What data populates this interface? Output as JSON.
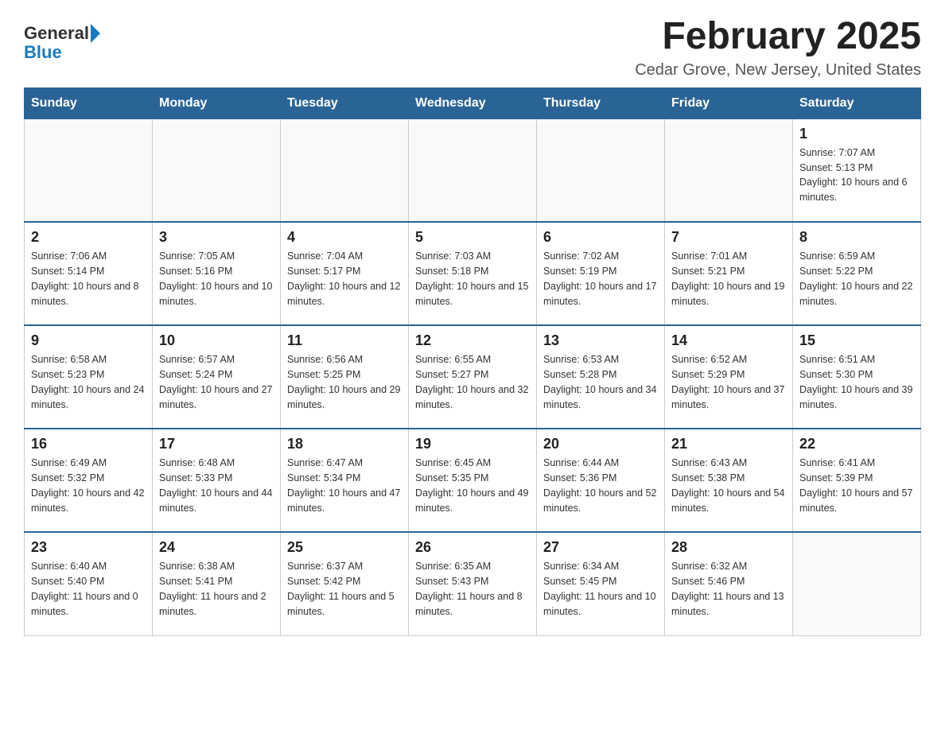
{
  "header": {
    "logo_general": "General",
    "logo_blue": "Blue",
    "title": "February 2025",
    "subtitle": "Cedar Grove, New Jersey, United States"
  },
  "days_of_week": [
    "Sunday",
    "Monday",
    "Tuesday",
    "Wednesday",
    "Thursday",
    "Friday",
    "Saturday"
  ],
  "weeks": [
    [
      {
        "date": "",
        "info": ""
      },
      {
        "date": "",
        "info": ""
      },
      {
        "date": "",
        "info": ""
      },
      {
        "date": "",
        "info": ""
      },
      {
        "date": "",
        "info": ""
      },
      {
        "date": "",
        "info": ""
      },
      {
        "date": "1",
        "info": "Sunrise: 7:07 AM\nSunset: 5:13 PM\nDaylight: 10 hours and 6 minutes."
      }
    ],
    [
      {
        "date": "2",
        "info": "Sunrise: 7:06 AM\nSunset: 5:14 PM\nDaylight: 10 hours and 8 minutes."
      },
      {
        "date": "3",
        "info": "Sunrise: 7:05 AM\nSunset: 5:16 PM\nDaylight: 10 hours and 10 minutes."
      },
      {
        "date": "4",
        "info": "Sunrise: 7:04 AM\nSunset: 5:17 PM\nDaylight: 10 hours and 12 minutes."
      },
      {
        "date": "5",
        "info": "Sunrise: 7:03 AM\nSunset: 5:18 PM\nDaylight: 10 hours and 15 minutes."
      },
      {
        "date": "6",
        "info": "Sunrise: 7:02 AM\nSunset: 5:19 PM\nDaylight: 10 hours and 17 minutes."
      },
      {
        "date": "7",
        "info": "Sunrise: 7:01 AM\nSunset: 5:21 PM\nDaylight: 10 hours and 19 minutes."
      },
      {
        "date": "8",
        "info": "Sunrise: 6:59 AM\nSunset: 5:22 PM\nDaylight: 10 hours and 22 minutes."
      }
    ],
    [
      {
        "date": "9",
        "info": "Sunrise: 6:58 AM\nSunset: 5:23 PM\nDaylight: 10 hours and 24 minutes."
      },
      {
        "date": "10",
        "info": "Sunrise: 6:57 AM\nSunset: 5:24 PM\nDaylight: 10 hours and 27 minutes."
      },
      {
        "date": "11",
        "info": "Sunrise: 6:56 AM\nSunset: 5:25 PM\nDaylight: 10 hours and 29 minutes."
      },
      {
        "date": "12",
        "info": "Sunrise: 6:55 AM\nSunset: 5:27 PM\nDaylight: 10 hours and 32 minutes."
      },
      {
        "date": "13",
        "info": "Sunrise: 6:53 AM\nSunset: 5:28 PM\nDaylight: 10 hours and 34 minutes."
      },
      {
        "date": "14",
        "info": "Sunrise: 6:52 AM\nSunset: 5:29 PM\nDaylight: 10 hours and 37 minutes."
      },
      {
        "date": "15",
        "info": "Sunrise: 6:51 AM\nSunset: 5:30 PM\nDaylight: 10 hours and 39 minutes."
      }
    ],
    [
      {
        "date": "16",
        "info": "Sunrise: 6:49 AM\nSunset: 5:32 PM\nDaylight: 10 hours and 42 minutes."
      },
      {
        "date": "17",
        "info": "Sunrise: 6:48 AM\nSunset: 5:33 PM\nDaylight: 10 hours and 44 minutes."
      },
      {
        "date": "18",
        "info": "Sunrise: 6:47 AM\nSunset: 5:34 PM\nDaylight: 10 hours and 47 minutes."
      },
      {
        "date": "19",
        "info": "Sunrise: 6:45 AM\nSunset: 5:35 PM\nDaylight: 10 hours and 49 minutes."
      },
      {
        "date": "20",
        "info": "Sunrise: 6:44 AM\nSunset: 5:36 PM\nDaylight: 10 hours and 52 minutes."
      },
      {
        "date": "21",
        "info": "Sunrise: 6:43 AM\nSunset: 5:38 PM\nDaylight: 10 hours and 54 minutes."
      },
      {
        "date": "22",
        "info": "Sunrise: 6:41 AM\nSunset: 5:39 PM\nDaylight: 10 hours and 57 minutes."
      }
    ],
    [
      {
        "date": "23",
        "info": "Sunrise: 6:40 AM\nSunset: 5:40 PM\nDaylight: 11 hours and 0 minutes."
      },
      {
        "date": "24",
        "info": "Sunrise: 6:38 AM\nSunset: 5:41 PM\nDaylight: 11 hours and 2 minutes."
      },
      {
        "date": "25",
        "info": "Sunrise: 6:37 AM\nSunset: 5:42 PM\nDaylight: 11 hours and 5 minutes."
      },
      {
        "date": "26",
        "info": "Sunrise: 6:35 AM\nSunset: 5:43 PM\nDaylight: 11 hours and 8 minutes."
      },
      {
        "date": "27",
        "info": "Sunrise: 6:34 AM\nSunset: 5:45 PM\nDaylight: 11 hours and 10 minutes."
      },
      {
        "date": "28",
        "info": "Sunrise: 6:32 AM\nSunset: 5:46 PM\nDaylight: 11 hours and 13 minutes."
      },
      {
        "date": "",
        "info": ""
      }
    ]
  ]
}
